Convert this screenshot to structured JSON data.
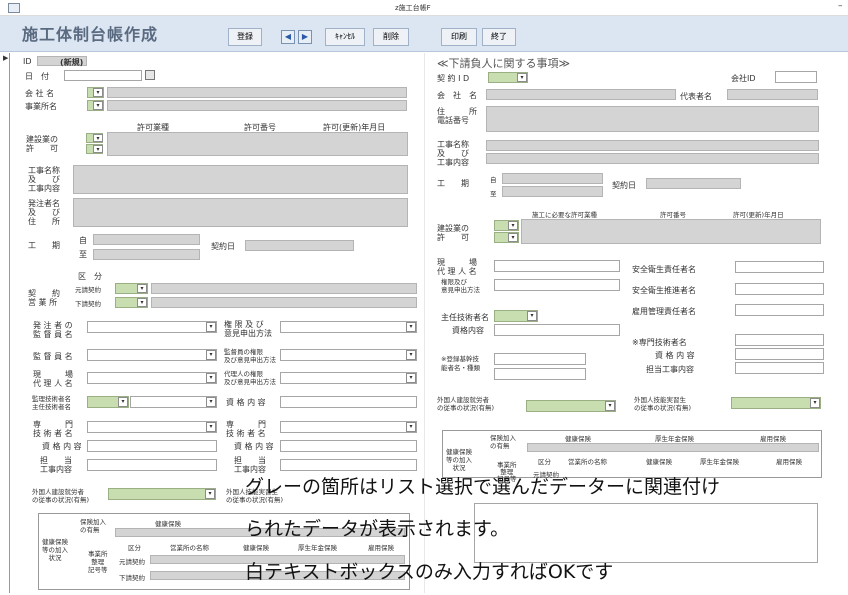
{
  "window": {
    "title": "z施工台帳F",
    "minimize": "–"
  },
  "header": {
    "form_title": "施工体制台帳作成"
  },
  "toolbar": {
    "register": "登録",
    "prev": "◀",
    "next": "▶",
    "cancel": "ｷｬﾝｾﾙ",
    "delete": "削除",
    "print": "印刷",
    "end": "終了"
  },
  "left": {
    "id_label": "ID",
    "id_value": "(新規)",
    "date_label": "日　付",
    "company_label": "会 社 名",
    "office_label": "事業所名",
    "permit_headers": [
      "許可業種",
      "許可番号",
      "許可(更新)年月日"
    ],
    "permit_label": "建設業の\n許　　可",
    "work_label": "工事名称\n及　　び\n工事内容",
    "client_label": "発注者名\n及　　び\n住　　所",
    "period_label": "工　　期",
    "from": "自",
    "to": "至",
    "contract_date": "契約日",
    "kubun": "区　分",
    "contract_label": "契　　約\n営 業 所",
    "moto": "元請契約",
    "shita": "下請契約",
    "client_supervisor": "発 注 者 の\n監 督 員 名",
    "authority_method": "権 限 及 び\n意見申出方法",
    "supervisor": "監 督 員 名",
    "supervisor_auth": "監督員の権限\n及び意見申出方法",
    "site_agent": "現　　　場\n代 理 人 名",
    "agent_auth": "代理人の権限\n及び意見申出方法",
    "chief_engineer": "監理技術者名\n主任技術者名",
    "qualification": "資 格 内 容",
    "specialist": "専　　　門\n技 術 者 名",
    "charge_work": "担　　当\n工事内容",
    "foreign_worker": "外国人建設就労者\nの従事の状況(有無)",
    "foreign_trainee": "外国人技能実習生\nの従事の状況(有無)",
    "insurance_title": "健康保険\n等の加入\n状況",
    "insurance_join": "保険加入\nの有無",
    "ins_cols": [
      "健康保険",
      "厚生年金保険",
      "雇用保険"
    ],
    "ins_sub": [
      "区分",
      "営業所の名称",
      "健康保険",
      "厚生年金保険",
      "雇用保険"
    ],
    "office_reg": "事業所\n整理\n記号等",
    "row_moto": "元請契約",
    "row_shita": "下請契約"
  },
  "right": {
    "section_title": "≪下請負人に関する事項≫",
    "contract_id": "契 約 I D",
    "company_id": "会社ID",
    "company_name": "会　社　名",
    "rep_name": "代表者名",
    "address": "住　　　所\n電話番号",
    "work_label": "工事名称\n及　　び\n工事内容",
    "period": "工　　期",
    "from": "自",
    "to": "至",
    "contract_date": "契約日",
    "permit_headers": [
      "施工に必要な許可業種",
      "許可番号",
      "許可(更新)年月日"
    ],
    "permit_label": "建設業の\n許　　可",
    "site_agent": "現　　　場\n代 理 人 名",
    "authority_method": "権限及び\n意見申出方法",
    "safety_chief": "安全衛生責任者名",
    "safety_promoter": "安全衛生推進者名",
    "employment_manager": "雇用管理責任者名",
    "chief_engineer": "主任技術者名",
    "qualification": "資格内容",
    "specialist": "※専門技術者名",
    "spec_qual": "資 格 内 容",
    "spec_work": "担当工事内容",
    "registered": "※登録基幹技\n能者名・種類",
    "foreign_worker": "外国人建設就労者\nの従事の状況(有無)",
    "foreign_trainee": "外国人技能実習生\nの従事の状況(有無)",
    "insurance_title": "健康保険\n等の加入\n状況",
    "insurance_join": "保険加入\nの有無",
    "ins_cols": [
      "健康保険",
      "厚生年金保険",
      "雇用保険"
    ],
    "ins_sub": [
      "区分",
      "営業所の名称",
      "健康保険",
      "厚生年金保険",
      "雇用保険"
    ],
    "office_reg": "事業所\n整理\n記号等",
    "row_moto": "元請契約",
    "remarks": "備考"
  },
  "overlay": [
    "グレーの箇所はリスト選択で選んだデーターに関連付け",
    "られたデータが表示されます。",
    "白テキストボックスのみ入力すればOKです"
  ]
}
